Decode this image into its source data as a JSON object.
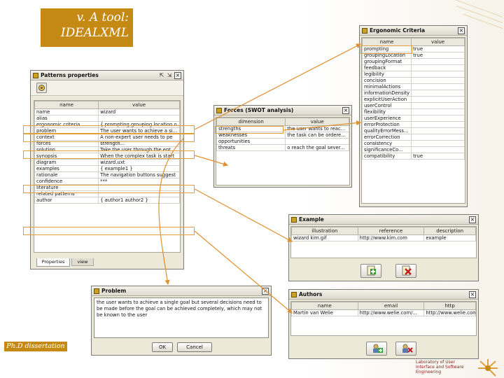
{
  "slide": {
    "title_line1": "v. A tool:",
    "title_line2": "IDEALXML",
    "footer": "Ph.D dissertation",
    "logo_text": "Laboratory of User Interface and Software Engineering"
  },
  "colors": {
    "accent": "#c48a14",
    "highlight": "#e0a040",
    "window_bg": "#ece9d8"
  },
  "patterns": {
    "title": "Patterns properties",
    "toolbar_icon": "properties-icon",
    "columns": [
      "name",
      "value"
    ],
    "rows": [
      [
        "name",
        "wizard"
      ],
      [
        "alias",
        ""
      ],
      [
        "ergonomic criteria",
        "{ prompting grouping location o..."
      ],
      [
        "problem",
        "The user wants to achieve a si..."
      ],
      [
        "context",
        "A non-expert user needs to pe"
      ],
      [
        "forces",
        "strength..."
      ],
      [
        "solution",
        "Take the user through the ent..."
      ],
      [
        "synopsis",
        "When the complex task is start"
      ],
      [
        "diagram",
        "wizard.uxt"
      ],
      [
        "examples",
        "{ example1 }"
      ],
      [
        "rationale",
        "The navigation buttons suggest"
      ],
      [
        "confidence",
        "***"
      ],
      [
        "literature",
        ""
      ],
      [
        "related patterns",
        ""
      ],
      [
        "author",
        "{ author1 author2 }"
      ]
    ],
    "tabs": [
      "Properties",
      "view"
    ]
  },
  "ergonomic": {
    "title": "Ergonomic Criteria",
    "columns": [
      "name",
      "value"
    ],
    "rows": [
      [
        "prompting",
        "true"
      ],
      [
        "groupingLocation",
        "true"
      ],
      [
        "groupingFormat",
        ""
      ],
      [
        "feedback",
        ""
      ],
      [
        "legibility",
        ""
      ],
      [
        "concision",
        ""
      ],
      [
        "minimalActions",
        ""
      ],
      [
        "informationDensity",
        ""
      ],
      [
        "explicitUserAction",
        ""
      ],
      [
        "userControl",
        ""
      ],
      [
        "flexibility",
        ""
      ],
      [
        "userExperience",
        ""
      ],
      [
        "errorProtection",
        ""
      ],
      [
        "qualityErrorMess...",
        ""
      ],
      [
        "errorCorrection",
        ""
      ],
      [
        "consistency",
        ""
      ],
      [
        "significanceCo...",
        ""
      ],
      [
        "compatibility",
        "true"
      ]
    ]
  },
  "forces": {
    "title": "Forces (SWOT analysis)",
    "columns": [
      "dimension",
      "value"
    ],
    "rows": [
      [
        "strengths",
        "the user wants to reac..."
      ],
      [
        "weaknesses",
        "the task can be ordere..."
      ],
      [
        "opportunities",
        ""
      ],
      [
        "threats",
        "o reach the goal sever..."
      ]
    ]
  },
  "example": {
    "title": "Example",
    "columns": [
      "illustration",
      "reference",
      "description"
    ],
    "rows": [
      [
        "wizard kim.gif",
        "http://www.kim.com",
        "example"
      ]
    ],
    "add_icon": "add-file-icon",
    "remove_icon": "remove-file-icon"
  },
  "problem": {
    "title": "Problem",
    "text": "the user wants to achieve a single goal but several decisions need to be made before the goal can be achieved completely, which may not be known to the user",
    "ok": "OK",
    "cancel": "Cancel"
  },
  "authors": {
    "title": "Authors",
    "columns": [
      "name",
      "email",
      "http"
    ],
    "rows": [
      [
        "Martin van Welie",
        "http://www.welie.com/...",
        "http://www.welie.com"
      ]
    ],
    "add_icon": "add-user-icon",
    "remove_icon": "remove-user-icon"
  }
}
